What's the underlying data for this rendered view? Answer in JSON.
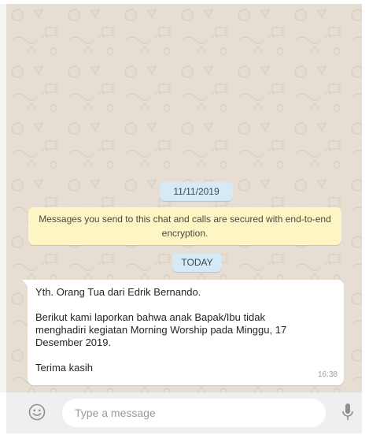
{
  "chat": {
    "date_chip": "11/11/2019",
    "encryption_notice": "Messages you send to this chat and calls are secured with end-to-end encryption.",
    "today_chip": "TODAY",
    "message": {
      "line1": "Yth. Orang Tua dari Edrik Bernando.",
      "line2": "Berikut kami laporkan bahwa anak Bapak/Ibu tidak",
      "line3": "menghadiri kegiatan Morning Worship pada Minggu, 17",
      "line4": "Desember 2019.",
      "line5": "Terima kasih",
      "time": "16:38"
    }
  },
  "composer": {
    "placeholder": "Type a message",
    "emoji_icon": "smiley-icon",
    "mic_icon": "microphone-icon"
  },
  "colors": {
    "chat_background": "#e6ded3",
    "date_chip": "#d5eaf6",
    "encryption_notice": "#fdf5c4",
    "incoming_bubble": "#ffffff",
    "composer_background": "#efefef"
  }
}
